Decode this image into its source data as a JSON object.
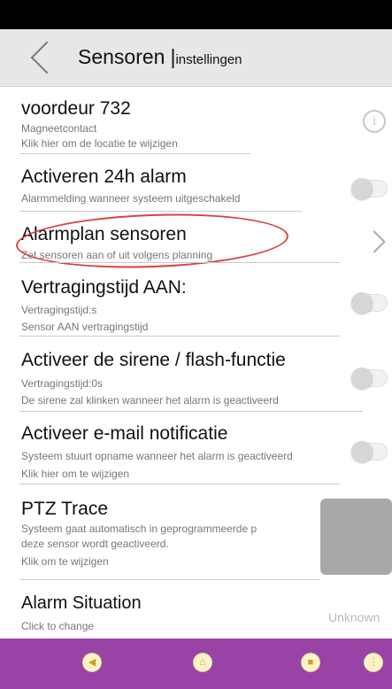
{
  "header": {
    "title": "Sensoren",
    "separator": "|",
    "subtitle": "instellingen",
    "back_icon": "chevron-left-icon"
  },
  "sensor": {
    "name": "voordeur 732",
    "type": "Magneetcontact",
    "location_hint": "Klik hier om de locatie te wijzigen",
    "info_icon": "info-icon",
    "info_glyph": "i"
  },
  "alarm24h": {
    "title": "Activeren 24h alarm",
    "desc": "Alarmmelding wanneer systeem uitgeschakeld",
    "enabled": false
  },
  "alarmplan": {
    "title": "Alarmplan sensoren",
    "desc": "Zet sensoren aan of uit volgens planning",
    "icon": "chevron-right-icon"
  },
  "delay": {
    "title": "Vertragingstijd AAN:",
    "line1": "Vertragingstijd:s",
    "line2": "Sensor AAN vertragingstijd",
    "enabled": false
  },
  "siren": {
    "title": "Activeer de sirene / flash-functie",
    "line1": "Vertragingstijd:0s",
    "line2": "De sirene zal klinken wanneer het alarm is geactiveerd",
    "enabled": false
  },
  "email": {
    "title": "Activeer e-mail notificatie",
    "line1": "Systeem stuurt opname wanneer het alarm is geactiveerd",
    "line2": "Klik hier om te wijzigen",
    "enabled": false
  },
  "ptz": {
    "title": "PTZ Trace",
    "line1": "Systeem gaat automatisch in geprogrammeerde p",
    "line2": "deze sensor wordt geactiveerd.",
    "line3": "Klik om te wijzigen"
  },
  "situation": {
    "title": "Alarm Situation",
    "desc": "Click to change",
    "value": "Unknown"
  },
  "navbar": {
    "buttons": [
      {
        "name": "back-nav-icon",
        "glyph": "◀"
      },
      {
        "name": "home-nav-icon",
        "glyph": "⌂"
      },
      {
        "name": "stop-nav-icon",
        "glyph": "■"
      },
      {
        "name": "more-nav-icon",
        "glyph": "⋮"
      }
    ]
  },
  "colors": {
    "navbar": "#9a43a6",
    "highlight_ellipse": "#d94141",
    "header_bg": "#e7e7e7"
  }
}
